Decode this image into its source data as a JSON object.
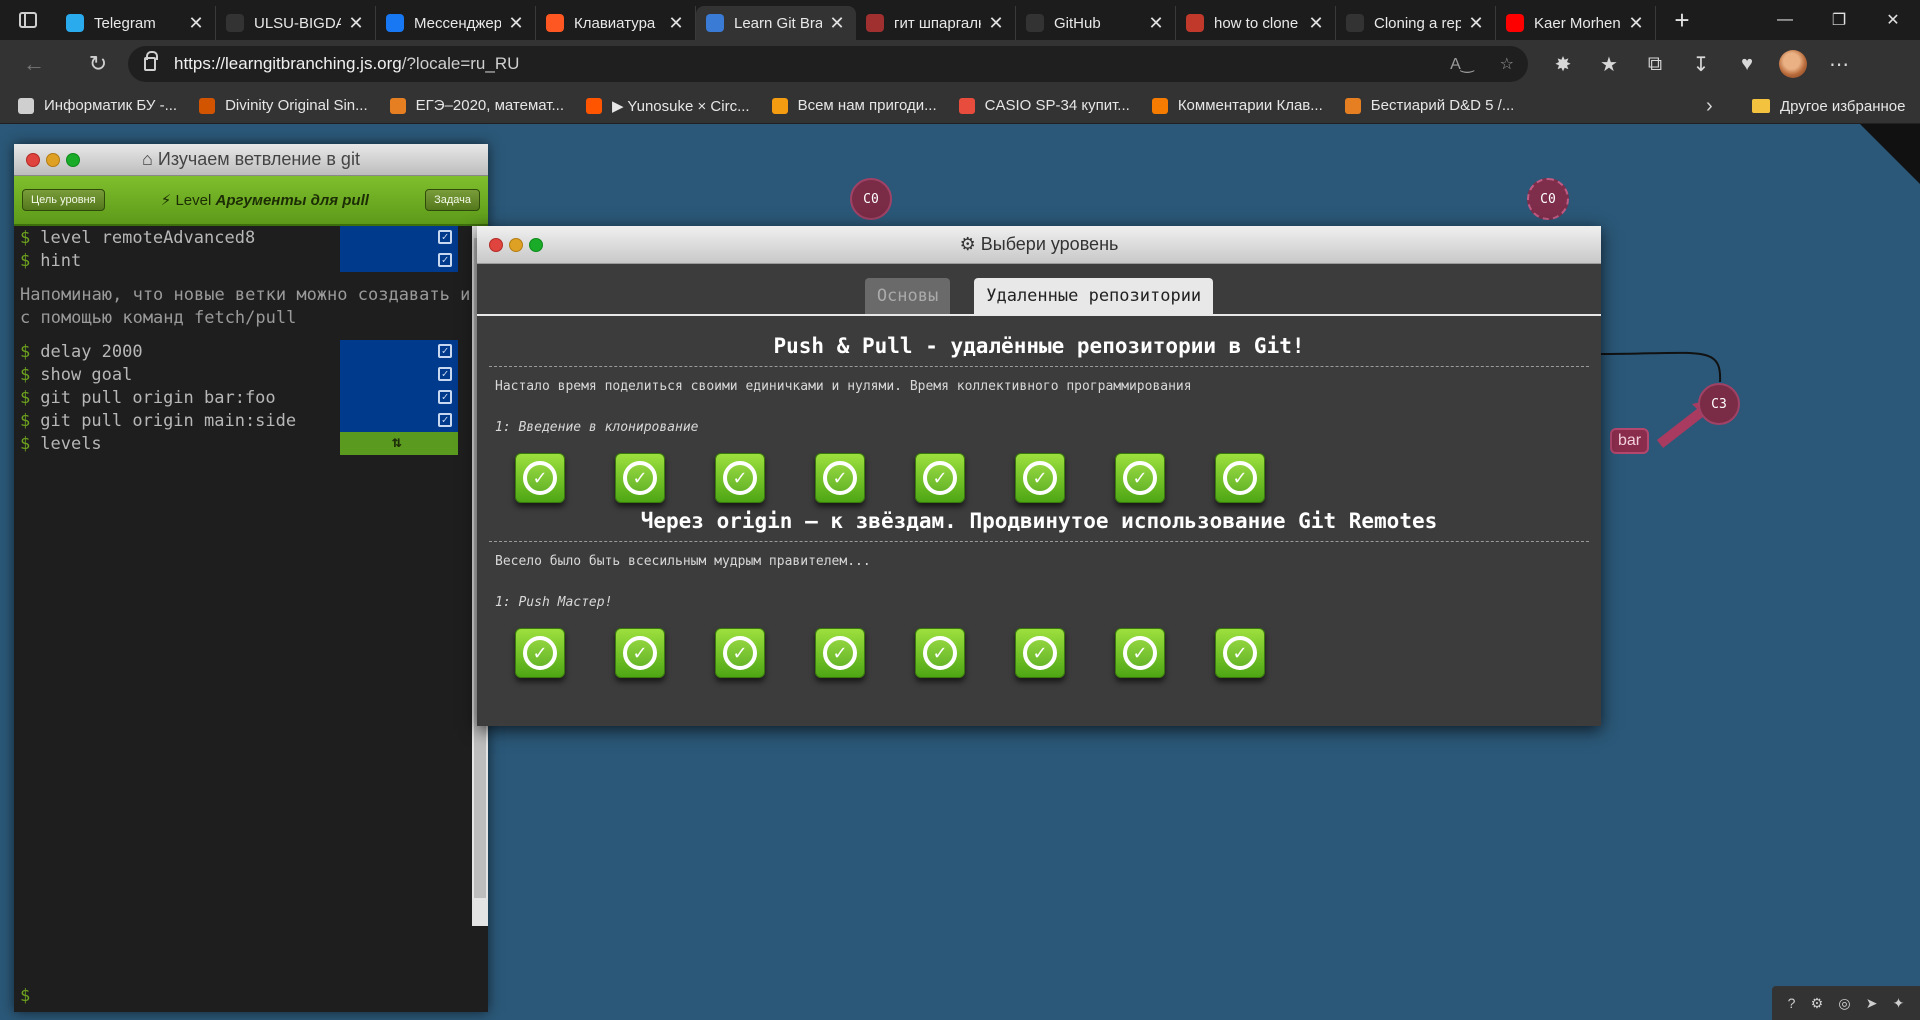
{
  "browser": {
    "tabs": [
      {
        "label": "Telegram",
        "icon": "telegram-icon",
        "color": "#2aabee",
        "active": false
      },
      {
        "label": "ULSU-BIGDATA",
        "icon": "github-icon",
        "color": "#333333",
        "active": false
      },
      {
        "label": "Мессенджер",
        "icon": "messenger-icon",
        "color": "#1877f2",
        "active": false
      },
      {
        "label": "Клавиатура",
        "icon": "klaviatura-icon",
        "color": "#ff5722",
        "active": false
      },
      {
        "label": "Learn Git Branching",
        "icon": "learngit-icon",
        "color": "#3a7bd5",
        "active": true
      },
      {
        "label": "гит шпаргалка",
        "icon": "pdf-icon",
        "color": "#a03030",
        "active": false
      },
      {
        "label": "GitHub",
        "icon": "github-icon",
        "color": "#333333",
        "active": false
      },
      {
        "label": "how to clone",
        "icon": "yandex-icon",
        "color": "#c0392b",
        "active": false
      },
      {
        "label": "Cloning a repo",
        "icon": "github-icon",
        "color": "#333333",
        "active": false
      },
      {
        "label": "Kaer Morhen",
        "icon": "youtube-icon",
        "color": "#ff0000",
        "active": false
      }
    ],
    "url": {
      "host": "https://learngitbranching.js.org",
      "path": "/?locale=ru_RU"
    },
    "bookmarks": [
      {
        "label": "Информатик БУ -...",
        "color": "#cfcfcf"
      },
      {
        "label": "Divinity Original Sin...",
        "color": "#d35400"
      },
      {
        "label": "ЕГЭ–2020, математ...",
        "color": "#e67e22"
      },
      {
        "label": "▶ Yunosuke × Circ...",
        "color": "#ff5500"
      },
      {
        "label": "Всем нам пригоди...",
        "color": "#f39c12"
      },
      {
        "label": "CASIO SP-34 купит...",
        "color": "#e74c3c"
      },
      {
        "label": "Комментарии Клав...",
        "color": "#f57c00"
      },
      {
        "label": "Бестиарий D&D 5 /...",
        "color": "#e67e22"
      }
    ],
    "other_bookmarks": "Другое избранное"
  },
  "terminal": {
    "title": "Изучаем ветвление в git",
    "goal_button": "Цель уровня",
    "task_button": "Задача",
    "level_prefix": "Level",
    "level_name": "Аргументы для pull",
    "commands_top": [
      {
        "text": "level remoteAdvanced8"
      },
      {
        "text": "hint"
      }
    ],
    "hint": "Напоминаю, что новые ветки можно создавать и с помощью команд fetch/pull",
    "commands_bottom": [
      {
        "text": "delay 2000"
      },
      {
        "text": "show goal"
      },
      {
        "text": "git pull origin bar:foo"
      },
      {
        "text": "git pull origin main:side"
      }
    ],
    "last_command": "levels",
    "prompt": "$"
  },
  "graph": {
    "commits": [
      "C0",
      "C0",
      "C3"
    ],
    "branch_label": "bar"
  },
  "dialog": {
    "title": "Выбери уровень",
    "tabs": [
      {
        "label": "Основы",
        "active": false
      },
      {
        "label": "Удаленные репозитории",
        "active": true
      }
    ],
    "sections": [
      {
        "title": "Push & Pull - удалённые репозитории в Git!",
        "description": "Настало время поделиться своими единичками и нулями. Время коллективного программирования",
        "subtitle": "1: Введение в клонирование",
        "levels_completed": 8
      },
      {
        "title": "Через origin – к звёздам. Продвинутое использование Git Remotes",
        "description": "Весело было быть всесильным мудрым правителем...",
        "subtitle": "1: Push Мастер!",
        "levels_completed": 8
      }
    ]
  }
}
